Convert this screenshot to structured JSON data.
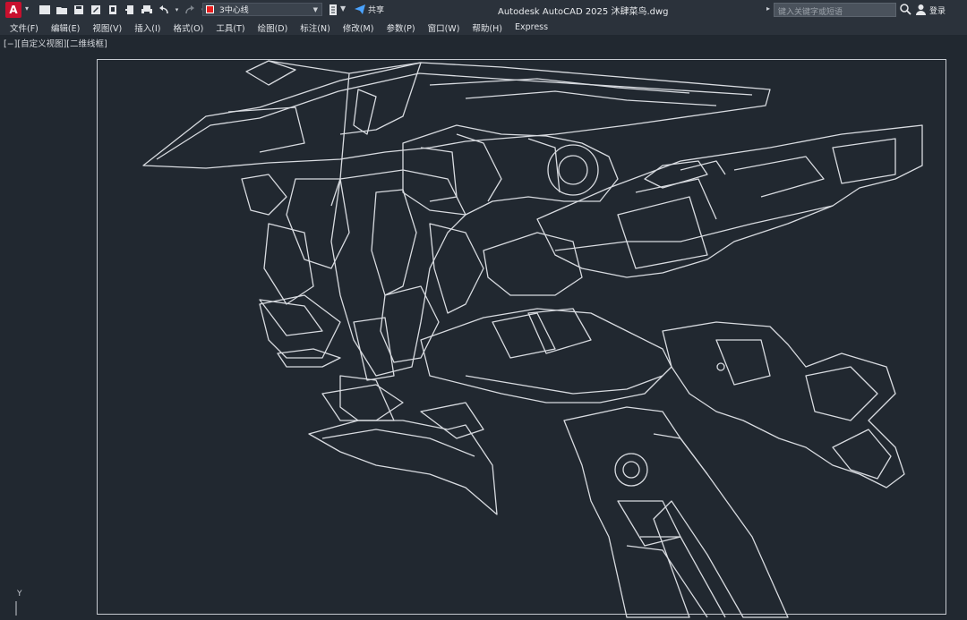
{
  "titlebar": {
    "app_logo": "A",
    "layer": {
      "name": "3中心线",
      "color": "#e81f1f"
    },
    "share_label": "共享",
    "doc_title": "Autodesk AutoCAD 2025    沐肆菜鸟.dwg",
    "search_placeholder": "键入关键字或短语",
    "login_label": "登录"
  },
  "menu": {
    "items": [
      "文件(F)",
      "编辑(E)",
      "视图(V)",
      "插入(I)",
      "格式(O)",
      "工具(T)",
      "绘图(D)",
      "标注(N)",
      "修改(M)",
      "参数(P)",
      "窗口(W)",
      "帮助(H)",
      "Express"
    ]
  },
  "viewport": {
    "label": "[−][自定义视图][二维线框]",
    "ucs_label": "Y"
  },
  "colors": {
    "background": "#212830",
    "linework": "#d8dbe0",
    "brand": "#c8102e"
  }
}
